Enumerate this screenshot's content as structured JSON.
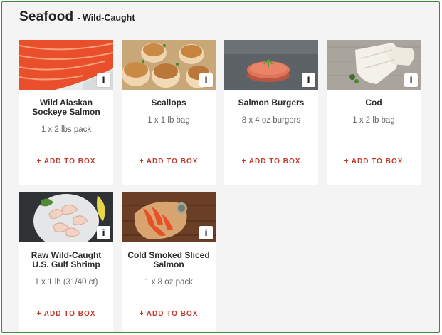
{
  "header": {
    "title": "Seafood",
    "subtitle": "- Wild-Caught"
  },
  "products": [
    {
      "name": "Wild Alaskan Sockeye Salmon",
      "pack": "1 x 2 lbs pack",
      "add_label": "+ ADD TO BOX",
      "info_label": "i"
    },
    {
      "name": "Scallops",
      "pack": "1 x 1 lb bag",
      "add_label": "+ ADD TO BOX",
      "info_label": "i"
    },
    {
      "name": "Salmon Burgers",
      "pack": "8 x 4 oz burgers",
      "add_label": "+ ADD TO BOX",
      "info_label": "i"
    },
    {
      "name": "Cod",
      "pack": "1 x 2 lb bag",
      "add_label": "+ ADD TO BOX",
      "info_label": "i"
    },
    {
      "name": "Raw Wild-Caught U.S. Gulf Shrimp",
      "pack": "1 x 1 lb (31/40 ct)",
      "add_label": "+ ADD TO BOX",
      "info_label": "i"
    },
    {
      "name": "Cold Smoked Sliced Salmon",
      "pack": "1 x 8 oz pack",
      "add_label": "+ ADD TO BOX",
      "info_label": "i"
    }
  ],
  "colors": {
    "accent": "#c0392b",
    "frame_border": "#3c8a3c",
    "background": "#f4f4f4"
  }
}
